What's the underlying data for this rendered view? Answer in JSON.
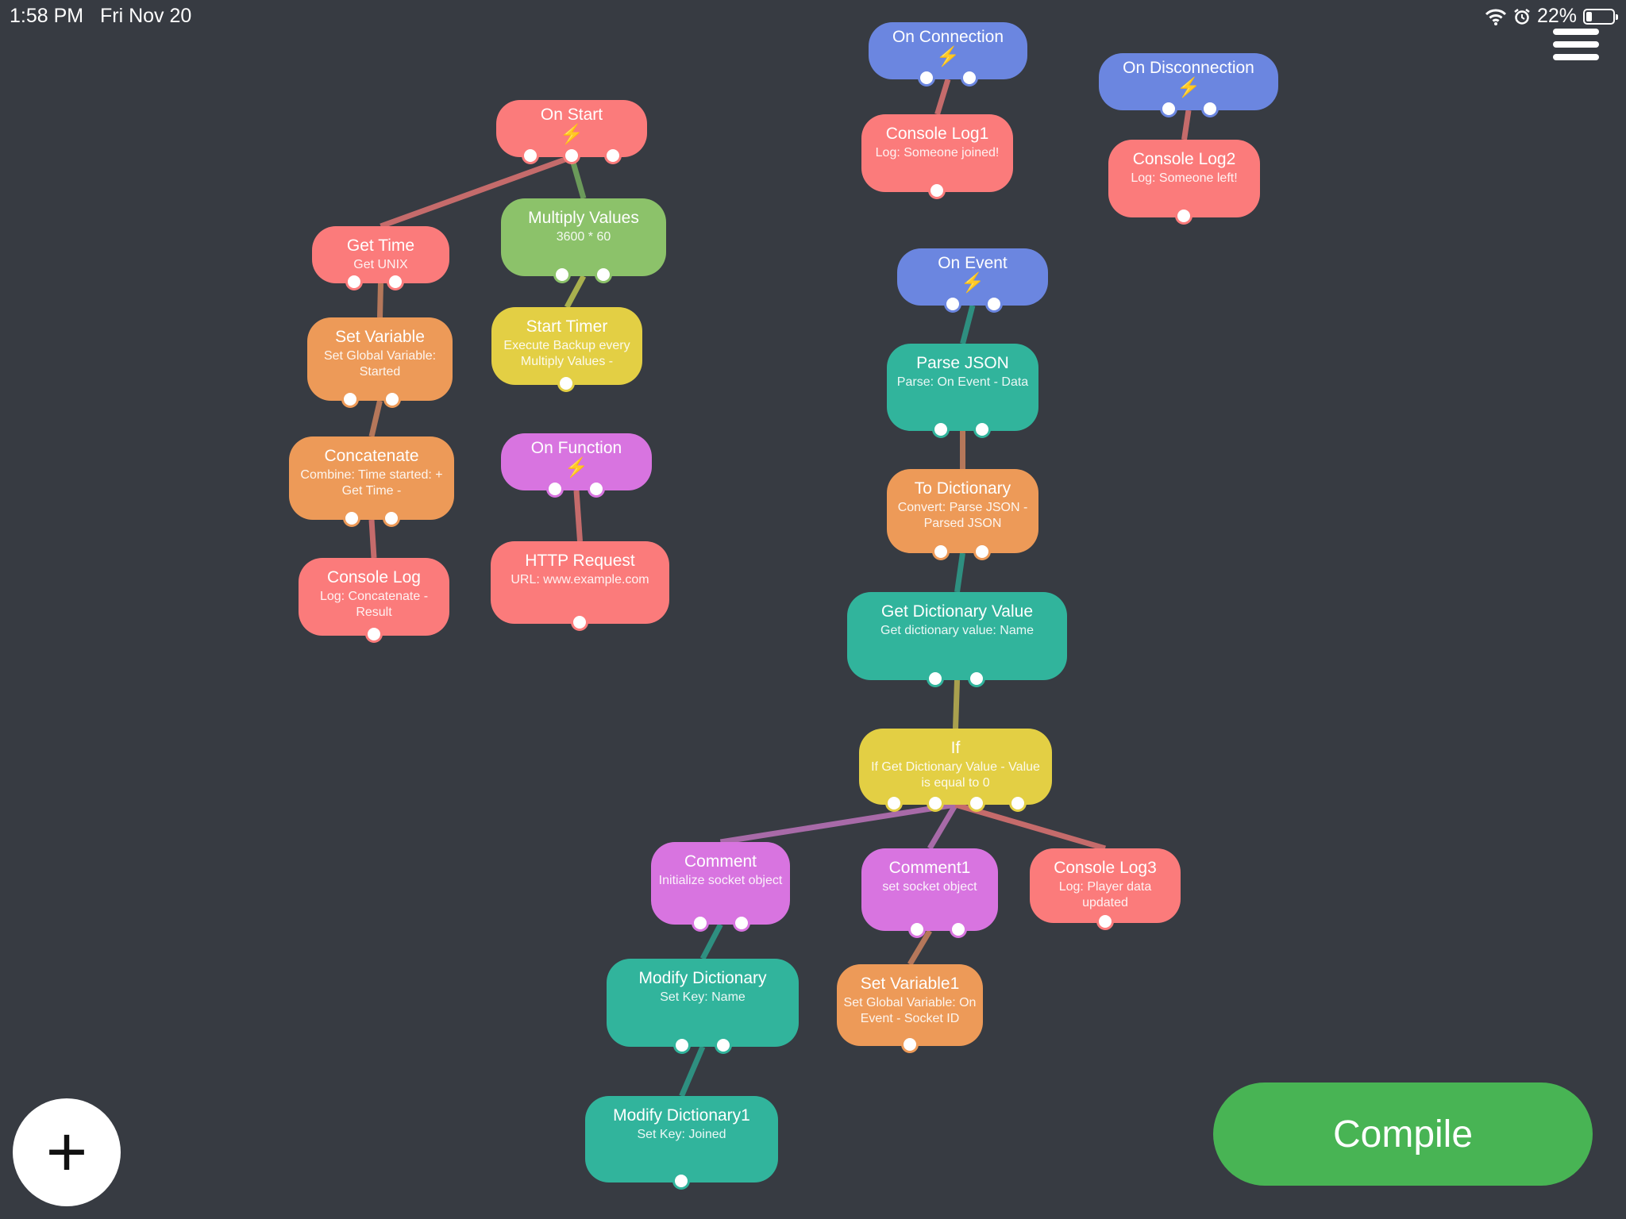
{
  "status_bar": {
    "time": "1:58 PM",
    "date": "Fri Nov 20",
    "battery": "22%",
    "battery_level": 0.22
  },
  "compile_label": "Compile",
  "add_label": "+",
  "nodes": [
    {
      "id": "on-start",
      "title": "On Start",
      "sub": "",
      "event": true,
      "color": "red"
    },
    {
      "id": "get-time",
      "title": "Get Time",
      "sub": "Get UNIX",
      "event": false,
      "color": "red"
    },
    {
      "id": "multiply-values",
      "title": "Multiply Values",
      "sub": "3600 * 60",
      "event": false,
      "color": "green"
    },
    {
      "id": "set-variable",
      "title": "Set Variable",
      "sub": "Set Global Variable: Started",
      "event": false,
      "color": "orange"
    },
    {
      "id": "start-timer",
      "title": "Start Timer",
      "sub": "Execute Backup every Multiply Values -",
      "event": false,
      "color": "yellow"
    },
    {
      "id": "concatenate",
      "title": "Concatenate",
      "sub": "Combine: Time started: + Get Time -",
      "event": false,
      "color": "orange"
    },
    {
      "id": "on-function",
      "title": "On Function",
      "sub": "",
      "event": true,
      "color": "purple"
    },
    {
      "id": "console-log",
      "title": "Console Log",
      "sub": "Log: Concatenate - Result",
      "event": false,
      "color": "red"
    },
    {
      "id": "http-request",
      "title": "HTTP Request",
      "sub": "URL: www.example.com",
      "event": false,
      "color": "red"
    },
    {
      "id": "on-connection",
      "title": "On Connection",
      "sub": "",
      "event": true,
      "color": "blue"
    },
    {
      "id": "console-log1",
      "title": "Console Log1",
      "sub": "Log: Someone joined!",
      "event": false,
      "color": "red"
    },
    {
      "id": "on-disconnection",
      "title": "On Disconnection",
      "sub": "",
      "event": true,
      "color": "blue"
    },
    {
      "id": "console-log2",
      "title": "Console Log2",
      "sub": "Log: Someone left!",
      "event": false,
      "color": "red"
    },
    {
      "id": "on-event",
      "title": "On Event",
      "sub": "",
      "event": true,
      "color": "blue"
    },
    {
      "id": "parse-json",
      "title": "Parse JSON",
      "sub": "Parse: On Event - Data",
      "event": false,
      "color": "teal"
    },
    {
      "id": "to-dictionary",
      "title": "To Dictionary",
      "sub": "Convert: Parse JSON - Parsed JSON",
      "event": false,
      "color": "orange"
    },
    {
      "id": "get-dictionary-value",
      "title": "Get Dictionary Value",
      "sub": "Get dictionary value: Name",
      "event": false,
      "color": "teal"
    },
    {
      "id": "if",
      "title": "If",
      "sub": "If Get Dictionary Value - Value is equal to 0",
      "event": false,
      "color": "yellow"
    },
    {
      "id": "comment",
      "title": "Comment",
      "sub": "Initialize socket object",
      "event": false,
      "color": "purple"
    },
    {
      "id": "comment1",
      "title": "Comment1",
      "sub": "set socket object",
      "event": false,
      "color": "purple"
    },
    {
      "id": "console-log3",
      "title": "Console Log3",
      "sub": "Log: Player data updated",
      "event": false,
      "color": "red"
    },
    {
      "id": "modify-dictionary",
      "title": "Modify Dictionary",
      "sub": "Set Key: Name",
      "event": false,
      "color": "teal"
    },
    {
      "id": "set-variable1",
      "title": "Set Variable1",
      "sub": "Set Global Variable: On Event - Socket ID",
      "event": false,
      "color": "orange"
    },
    {
      "id": "modify-dictionary1",
      "title": "Modify Dictionary1",
      "sub": "Set Key: Joined",
      "event": false,
      "color": "teal"
    }
  ],
  "connections": [
    {
      "from": "on-start",
      "to": "get-time",
      "color": "#c56b6b"
    },
    {
      "from": "on-start",
      "to": "multiply-values",
      "color": "#6b9a5a"
    },
    {
      "from": "get-time",
      "to": "set-variable",
      "color": "#b5775a"
    },
    {
      "from": "multiply-values",
      "to": "start-timer",
      "color": "#a9b04e"
    },
    {
      "from": "set-variable",
      "to": "concatenate",
      "color": "#b5775a"
    },
    {
      "from": "concatenate",
      "to": "console-log",
      "color": "#c56b6b"
    },
    {
      "from": "on-function",
      "to": "http-request",
      "color": "#c56b6b"
    },
    {
      "from": "on-connection",
      "to": "console-log1",
      "color": "#c56b6b"
    },
    {
      "from": "on-disconnection",
      "to": "console-log2",
      "color": "#c56b6b"
    },
    {
      "from": "on-event",
      "to": "parse-json",
      "color": "#2e8f80"
    },
    {
      "from": "parse-json",
      "to": "to-dictionary",
      "color": "#b5775a"
    },
    {
      "from": "to-dictionary",
      "to": "get-dictionary-value",
      "color": "#2e8f80"
    },
    {
      "from": "get-dictionary-value",
      "to": "if",
      "color": "#a9a04e"
    },
    {
      "from": "if",
      "to": "comment",
      "color": "#a86aa8"
    },
    {
      "from": "if",
      "to": "comment1",
      "color": "#a86aa8"
    },
    {
      "from": "if",
      "to": "console-log3",
      "color": "#c56b6b"
    },
    {
      "from": "comment",
      "to": "modify-dictionary",
      "color": "#2e8f80"
    },
    {
      "from": "comment1",
      "to": "set-variable1",
      "color": "#b5775a"
    },
    {
      "from": "modify-dictionary",
      "to": "modify-dictionary1",
      "color": "#2e8f80"
    }
  ]
}
